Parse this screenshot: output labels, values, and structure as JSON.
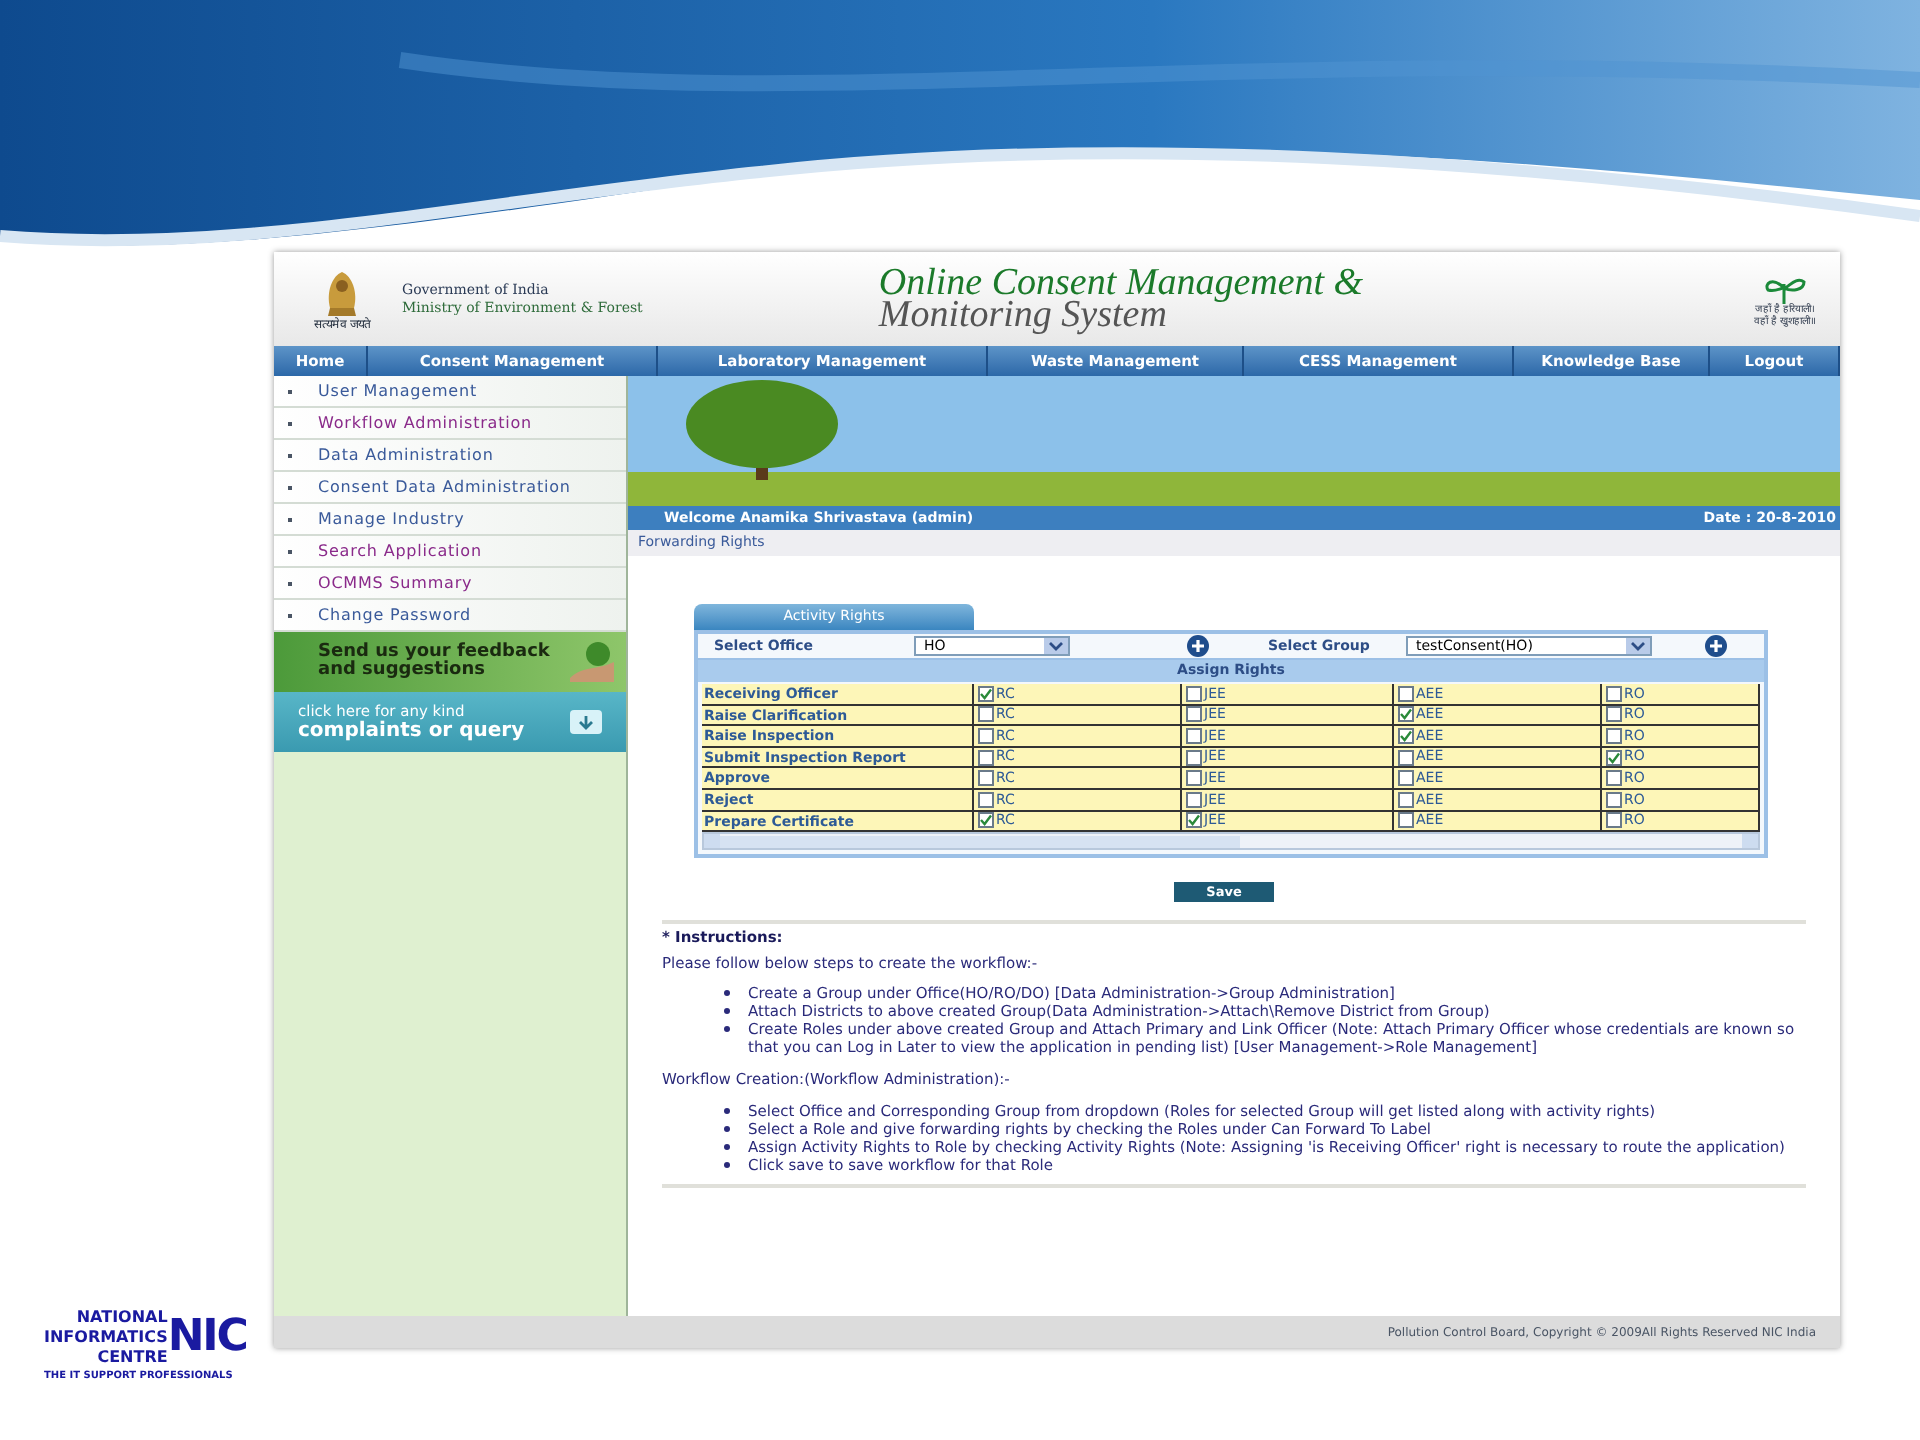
{
  "header": {
    "emblem_motto": "सत्यमेव जयते",
    "org_line1": "Government of India",
    "org_line2": "Ministry of Environment & Forest",
    "title_line1": "Online Consent Management &",
    "title_line2": "Monitoring System",
    "slogan_line1": "जहाँ है हरियाली।",
    "slogan_line2": "वहाँ है खुशहाली॥"
  },
  "nav": [
    "Home",
    "Consent Management",
    "Laboratory Management",
    "Waste Management",
    "CESS Management",
    "Knowledge Base",
    "Logout"
  ],
  "sidebar": {
    "items": [
      {
        "label": "User Management",
        "visited": false
      },
      {
        "label": "Workflow Administration",
        "visited": true
      },
      {
        "label": "Data Administration",
        "visited": false
      },
      {
        "label": "Consent Data Administration",
        "visited": false
      },
      {
        "label": "Manage Industry",
        "visited": false
      },
      {
        "label": "Search Application",
        "visited": true
      },
      {
        "label": "OCMMS Summary",
        "visited": true
      },
      {
        "label": "Change Password",
        "visited": false
      }
    ],
    "feedback_line1": "Send us your feedback",
    "feedback_line2": "and suggestions",
    "complaints_line1": "click here for any kind",
    "complaints_line2": "complaints or query"
  },
  "welcome": "Welcome Anamika Shrivastava (admin)",
  "date": "Date : 20-8-2010",
  "breadcrumb": "Forwarding Rights",
  "activity": {
    "tab": "Activity Rights",
    "office_label": "Select Office",
    "office_value": "HO",
    "group_label": "Select Group",
    "group_value": "testConsent(HO)",
    "section": "Assign Rights",
    "rows": [
      {
        "label": "Receiving Officer",
        "options": [
          {
            "label": "RC",
            "checked": true
          },
          {
            "label": "JEE",
            "checked": false
          },
          {
            "label": "AEE",
            "checked": false
          },
          {
            "label": "RO",
            "checked": false
          }
        ]
      },
      {
        "label": "Raise Clarification",
        "options": [
          {
            "label": "RC",
            "checked": false
          },
          {
            "label": "JEE",
            "checked": false
          },
          {
            "label": "AEE",
            "checked": true
          },
          {
            "label": "RO",
            "checked": false
          }
        ]
      },
      {
        "label": "Raise Inspection",
        "options": [
          {
            "label": "RC",
            "checked": false
          },
          {
            "label": "JEE",
            "checked": false
          },
          {
            "label": "AEE",
            "checked": true
          },
          {
            "label": "RO",
            "checked": false
          }
        ]
      },
      {
        "label": "Submit Inspection Report",
        "options": [
          {
            "label": "RC",
            "checked": false
          },
          {
            "label": "JEE",
            "checked": false
          },
          {
            "label": "AEE",
            "checked": false
          },
          {
            "label": "RO",
            "checked": true
          }
        ]
      },
      {
        "label": "Approve",
        "options": [
          {
            "label": "RC",
            "checked": false
          },
          {
            "label": "JEE",
            "checked": false
          },
          {
            "label": "AEE",
            "checked": false
          },
          {
            "label": "RO",
            "checked": false
          }
        ]
      },
      {
        "label": "Reject",
        "options": [
          {
            "label": "RC",
            "checked": false
          },
          {
            "label": "JEE",
            "checked": false
          },
          {
            "label": "AEE",
            "checked": false
          },
          {
            "label": "RO",
            "checked": false
          }
        ]
      },
      {
        "label": "Prepare Certificate",
        "options": [
          {
            "label": "RC",
            "checked": true
          },
          {
            "label": "JEE",
            "checked": true
          },
          {
            "label": "AEE",
            "checked": false
          },
          {
            "label": "RO",
            "checked": false
          }
        ]
      }
    ],
    "save": "Save"
  },
  "instructions": {
    "heading": "* Instructions:",
    "intro": "Please follow below steps to create the workflow:-",
    "steps": [
      "Create a Group under Office(HO/RO/DO) [Data Administration->Group Administration]",
      "Attach Districts to above created Group(Data Administration->Attach\\Remove District from Group)",
      "Create Roles under above created Group and Attach Primary and Link Officer (Note: Attach Primary Officer whose credentials are known so that you can Log in Later to view the application in pending list) [User Management->Role Management]"
    ],
    "workflow_heading": "Workflow Creation:(Workflow Administration):-",
    "workflow_steps": [
      "Select Office and Corresponding Group from dropdown (Roles for selected Group will get listed along with activity rights)",
      "Select a Role and give forwarding rights by checking the Roles under Can Forward To Label",
      "Assign Activity Rights to Role by checking Activity Rights (Note: Assigning 'is Receiving Officer' right is necessary to route the application)",
      "Click save to save workflow for that Role"
    ]
  },
  "footer": "Pollution Control Board, Copyright © 2009All Rights Reserved NIC India",
  "nic_logo": {
    "line1": "NATIONAL",
    "line2": "INFORMATICS",
    "line3": "CENTRE",
    "mark": "NIC",
    "tagline": "THE IT SUPPORT PROFESSIONALS"
  }
}
